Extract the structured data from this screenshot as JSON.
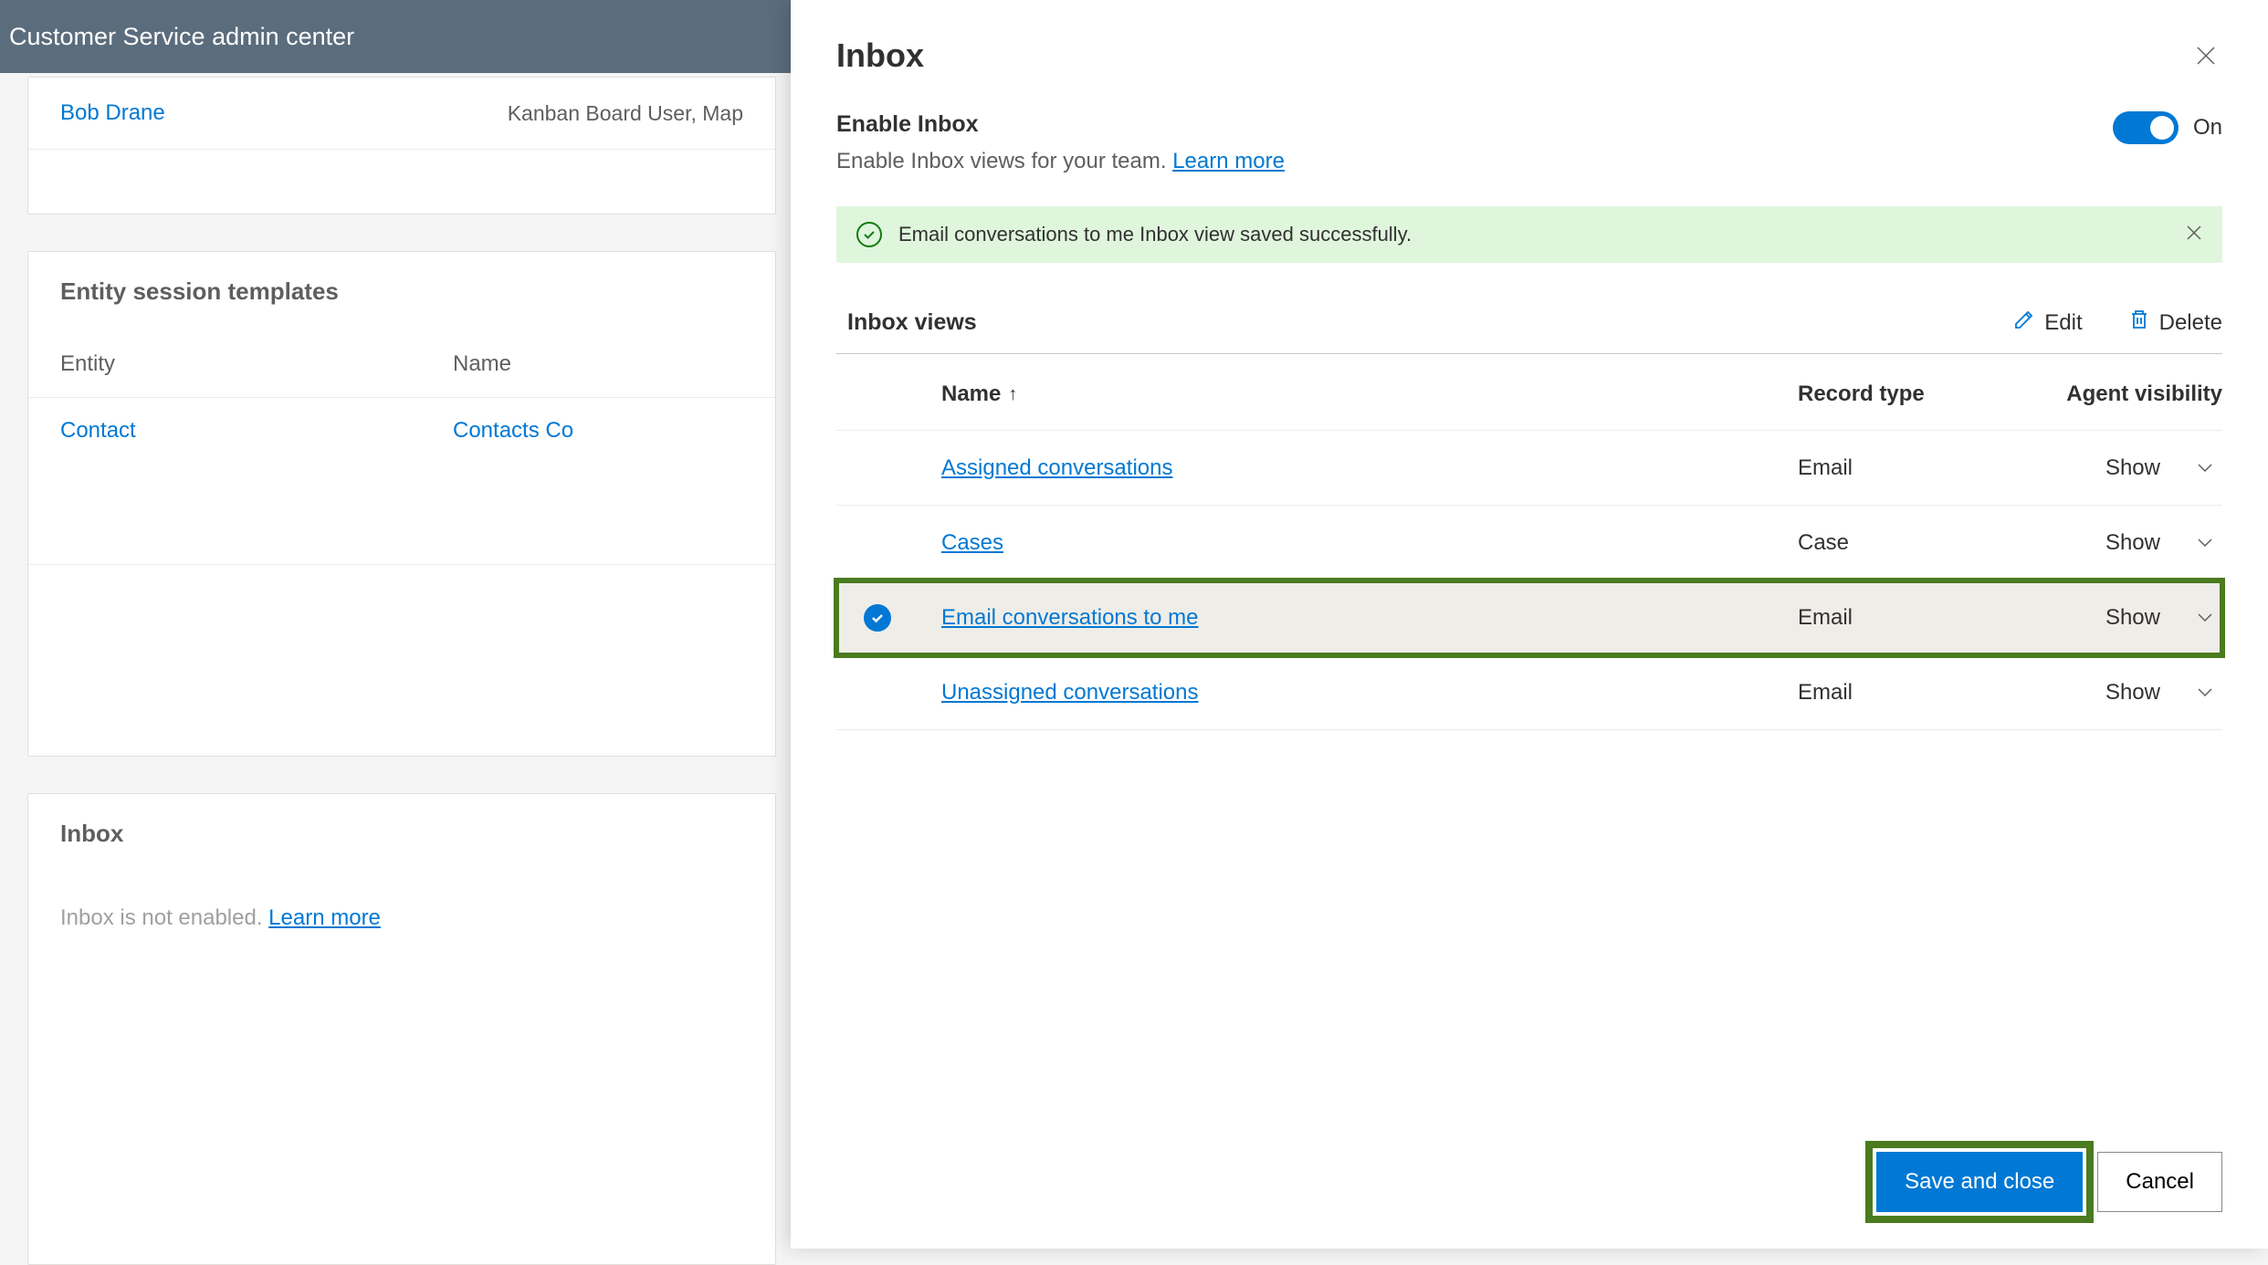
{
  "header": {
    "title": "Customer Service admin center"
  },
  "bg": {
    "userName": "Bob Drane",
    "userRoles": "Kanban Board User, Map",
    "entitySection": "Entity session templates",
    "colEntity": "Entity",
    "colName": "Name",
    "rowEntity": "Contact",
    "rowName": "Contacts Co",
    "inboxSection": "Inbox",
    "inboxDisabled": "Inbox is not enabled. ",
    "inboxLink": "Learn more"
  },
  "panel": {
    "title": "Inbox",
    "enableLabel": "Enable Inbox",
    "enableDesc": "Enable Inbox views for your team. ",
    "enableLink": "Learn more",
    "toggleState": "On",
    "successMsg": "Email conversations to me Inbox view saved successfully.",
    "viewsTitle": "Inbox views",
    "editLabel": "Edit",
    "deleteLabel": "Delete",
    "colName": "Name",
    "colRecord": "Record type",
    "colVisibility": "Agent visibility",
    "rows": [
      {
        "name": "Assigned conversations",
        "record": "Email",
        "visibility": "Show",
        "selected": false
      },
      {
        "name": "Cases",
        "record": "Case",
        "visibility": "Show",
        "selected": false
      },
      {
        "name": "Email conversations to me",
        "record": "Email",
        "visibility": "Show",
        "selected": true
      },
      {
        "name": "Unassigned conversations",
        "record": "Email",
        "visibility": "Show",
        "selected": false
      }
    ],
    "saveLabel": "Save and close",
    "cancelLabel": "Cancel"
  }
}
